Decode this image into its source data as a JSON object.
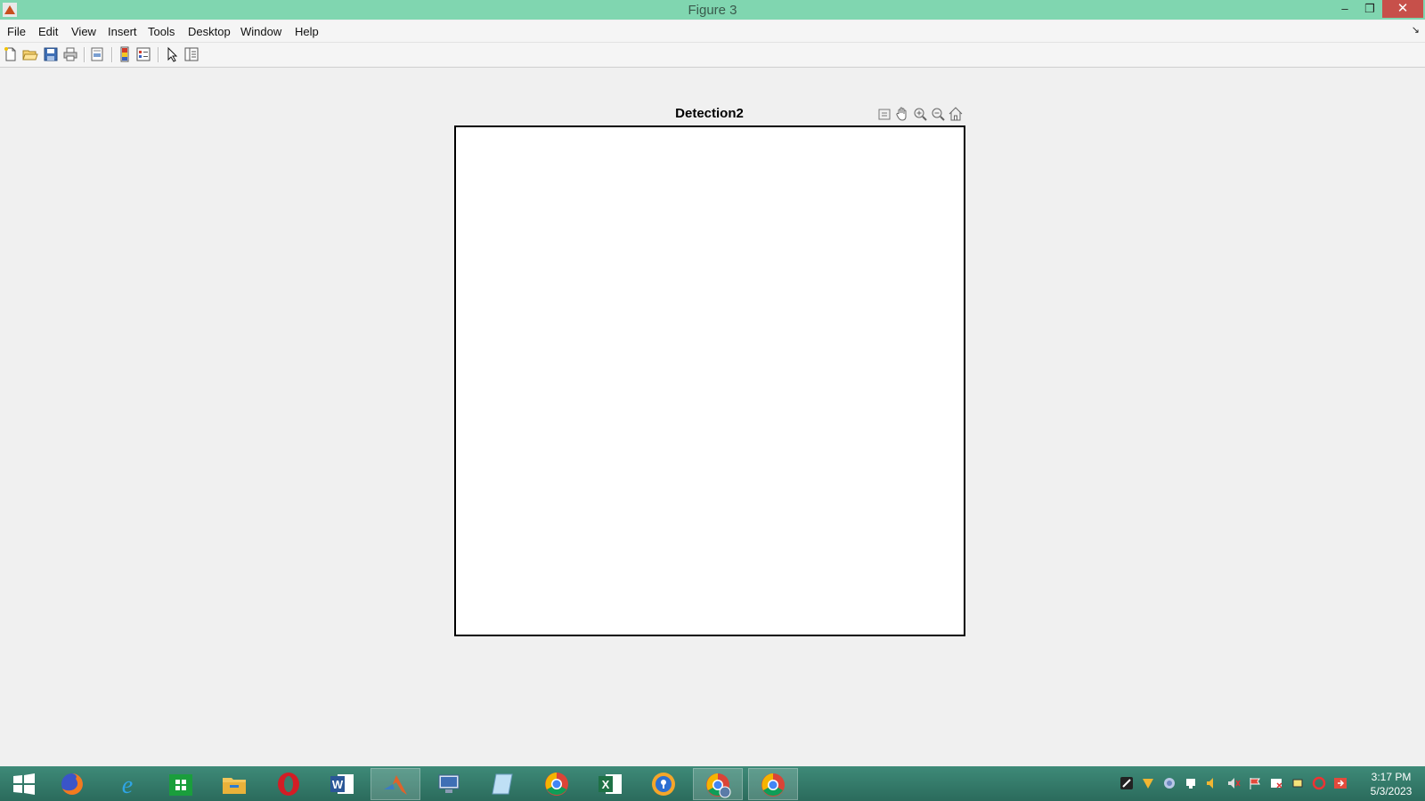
{
  "window": {
    "title": "Figure 3",
    "controls": {
      "minimize": "–",
      "maximize": "❐",
      "close": "✕"
    }
  },
  "menubar": {
    "items": [
      "File",
      "Edit",
      "View",
      "Insert",
      "Tools",
      "Desktop",
      "Window",
      "Help"
    ],
    "dock_glyph": "↘"
  },
  "toolbar": {
    "buttons": [
      "new-figure-icon",
      "open-file-icon",
      "save-icon",
      "print-icon",
      "print-preview-icon",
      "colorbar-icon",
      "legend-icon",
      "edit-plot-icon",
      "property-inspector-icon"
    ]
  },
  "axes": {
    "title": "Detection2",
    "toolbar": [
      "export-icon",
      "pan-hand-icon",
      "zoom-in-icon",
      "zoom-out-icon",
      "home-icon"
    ]
  },
  "taskbar": {
    "apps": [
      "start-icon",
      "firefox-icon",
      "internet-explorer-icon",
      "store-icon",
      "file-explorer-icon",
      "opera-icon",
      "word-icon",
      "matlab-icon",
      "remote-desktop-icon",
      "notepad-icon",
      "chrome-icon",
      "excel-icon",
      "vpn-icon",
      "chrome-profile-icon",
      "chrome-icon"
    ],
    "clock": {
      "time": "3:17 PM",
      "date": "5/3/2023"
    }
  },
  "colors": {
    "titlebar": "#80d6b0",
    "close": "#c7504a",
    "taskbar": "#2b6b5c",
    "figure_bg": "#f0f0f0",
    "axes_bg": "#ffffff"
  }
}
